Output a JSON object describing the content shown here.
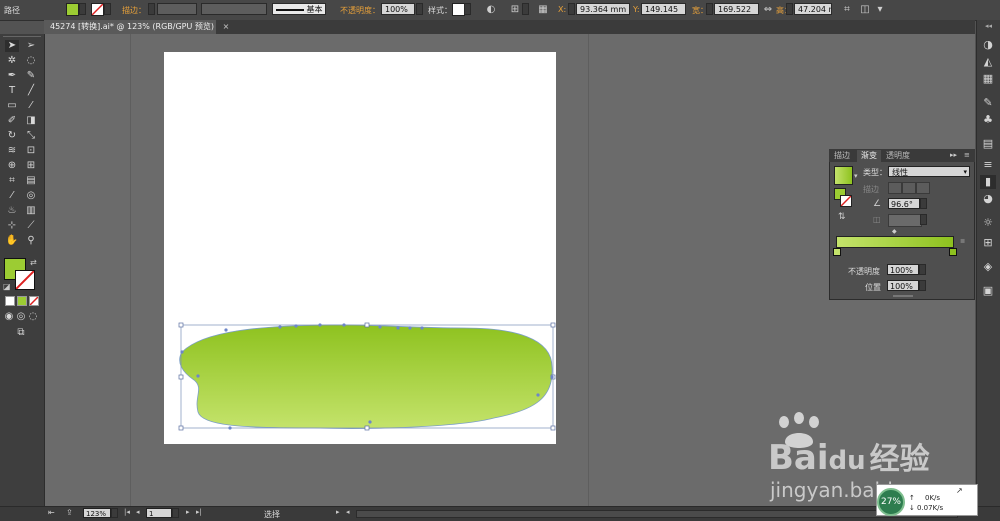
{
  "control_bar": {
    "path_label": "路径",
    "stroke_label": "描边：",
    "stroke_style": "基本",
    "opacity_label": "不透明度：",
    "opacity_value": "100%",
    "style_label": "样式：",
    "x_label": "X:",
    "x_value": "93.364 mm",
    "y_label": "Y:",
    "y_value": "149.145 ",
    "w_label": "宽：",
    "w_value": "169.522 ",
    "h_label": "高：",
    "h_value": "47.204 mm",
    "colors": {
      "fill": "#9ccc33",
      "accent": "#e8a13a"
    }
  },
  "document_tab": {
    "title": "45274 [转换].ai* @ 123% (RGB/GPU 预览)",
    "close": "×"
  },
  "gradient_panel": {
    "tabs": [
      "描边",
      "渐变",
      "透明度"
    ],
    "active_tab": "渐变",
    "type_label": "类型：",
    "type_value": "线性",
    "stroke_label": "描边",
    "angle_value": "96.6°",
    "opacity_label": "不透明度",
    "opacity_value": "100%",
    "location_label": "位置",
    "location_value": "100%",
    "gradient_start": "#c4e36b",
    "gradient_end": "#8ec21f"
  },
  "status_bar": {
    "zoom": "123%",
    "artboard": "1",
    "tool": "选择"
  },
  "network_widget": {
    "percent": "27%",
    "up": "0K/s",
    "down": "0.07K/s"
  },
  "watermark": {
    "brand": "Bai",
    "brand_du": "du",
    "brand_cn": "经验",
    "url": "jingyan.baidu.com"
  }
}
